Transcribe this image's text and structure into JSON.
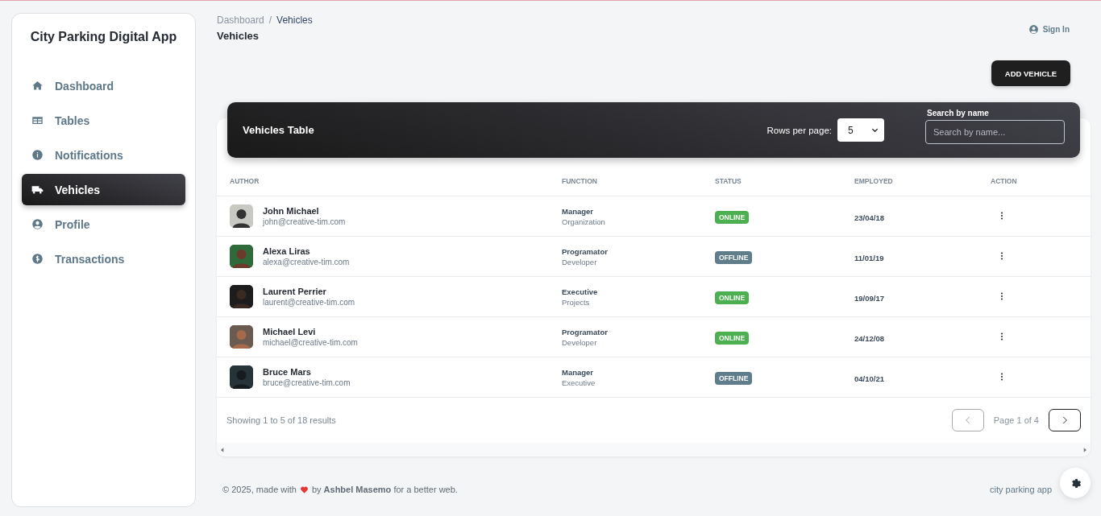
{
  "sidebar": {
    "brand": "City Parking Digital App",
    "items": [
      {
        "label": "Dashboard",
        "kind": "home",
        "selected": false
      },
      {
        "label": "Tables",
        "kind": "table",
        "selected": false
      },
      {
        "label": "Notifications",
        "kind": "info",
        "selected": false
      },
      {
        "label": "Vehicles",
        "kind": "truck",
        "selected": true
      },
      {
        "label": "Profile",
        "kind": "user",
        "selected": false
      },
      {
        "label": "Transactions",
        "kind": "dollar",
        "selected": false
      }
    ]
  },
  "topbar": {
    "breadcrumb": [
      "Dashboard",
      "Vehicles"
    ],
    "separator": "/",
    "title": "Vehicles",
    "sign_in": "Sign In"
  },
  "add_button": "ADD VEHICLE",
  "table": {
    "title": "Vehicles Table",
    "rows_per_page_label": "Rows per page:",
    "rows_per_page": "5",
    "search_label": "Search by name",
    "search_placeholder": "Search by name...",
    "columns": [
      "AUTHOR",
      "FUNCTION",
      "STATUS",
      "EMPLOYED",
      "ACTION"
    ],
    "rows": [
      {
        "name": "John Michael",
        "email": "john@creative-tim.com",
        "role": "Manager",
        "department": "Organization",
        "status": "ONLINE",
        "online": true,
        "employed": "23/04/18"
      },
      {
        "name": "Alexa Liras",
        "email": "alexa@creative-tim.com",
        "role": "Programator",
        "department": "Developer",
        "status": "OFFLINE",
        "online": false,
        "employed": "11/01/19"
      },
      {
        "name": "Laurent Perrier",
        "email": "laurent@creative-tim.com",
        "role": "Executive",
        "department": "Projects",
        "status": "ONLINE",
        "online": true,
        "employed": "19/09/17"
      },
      {
        "name": "Michael Levi",
        "email": "michael@creative-tim.com",
        "role": "Programator",
        "department": "Developer",
        "status": "ONLINE",
        "online": true,
        "employed": "24/12/08"
      },
      {
        "name": "Bruce Mars",
        "email": "bruce@creative-tim.com",
        "role": "Manager",
        "department": "Executive",
        "status": "OFFLINE",
        "online": false,
        "employed": "04/10/21"
      }
    ],
    "summary": "Showing 1 to 5 of 18 results",
    "page_info": "Page 1 of 4"
  },
  "footer": {
    "before_heart": "© 2025, made with",
    "after_heart": "by **Ashbel Masemo** for a better web.",
    "right": "city parking app"
  }
}
